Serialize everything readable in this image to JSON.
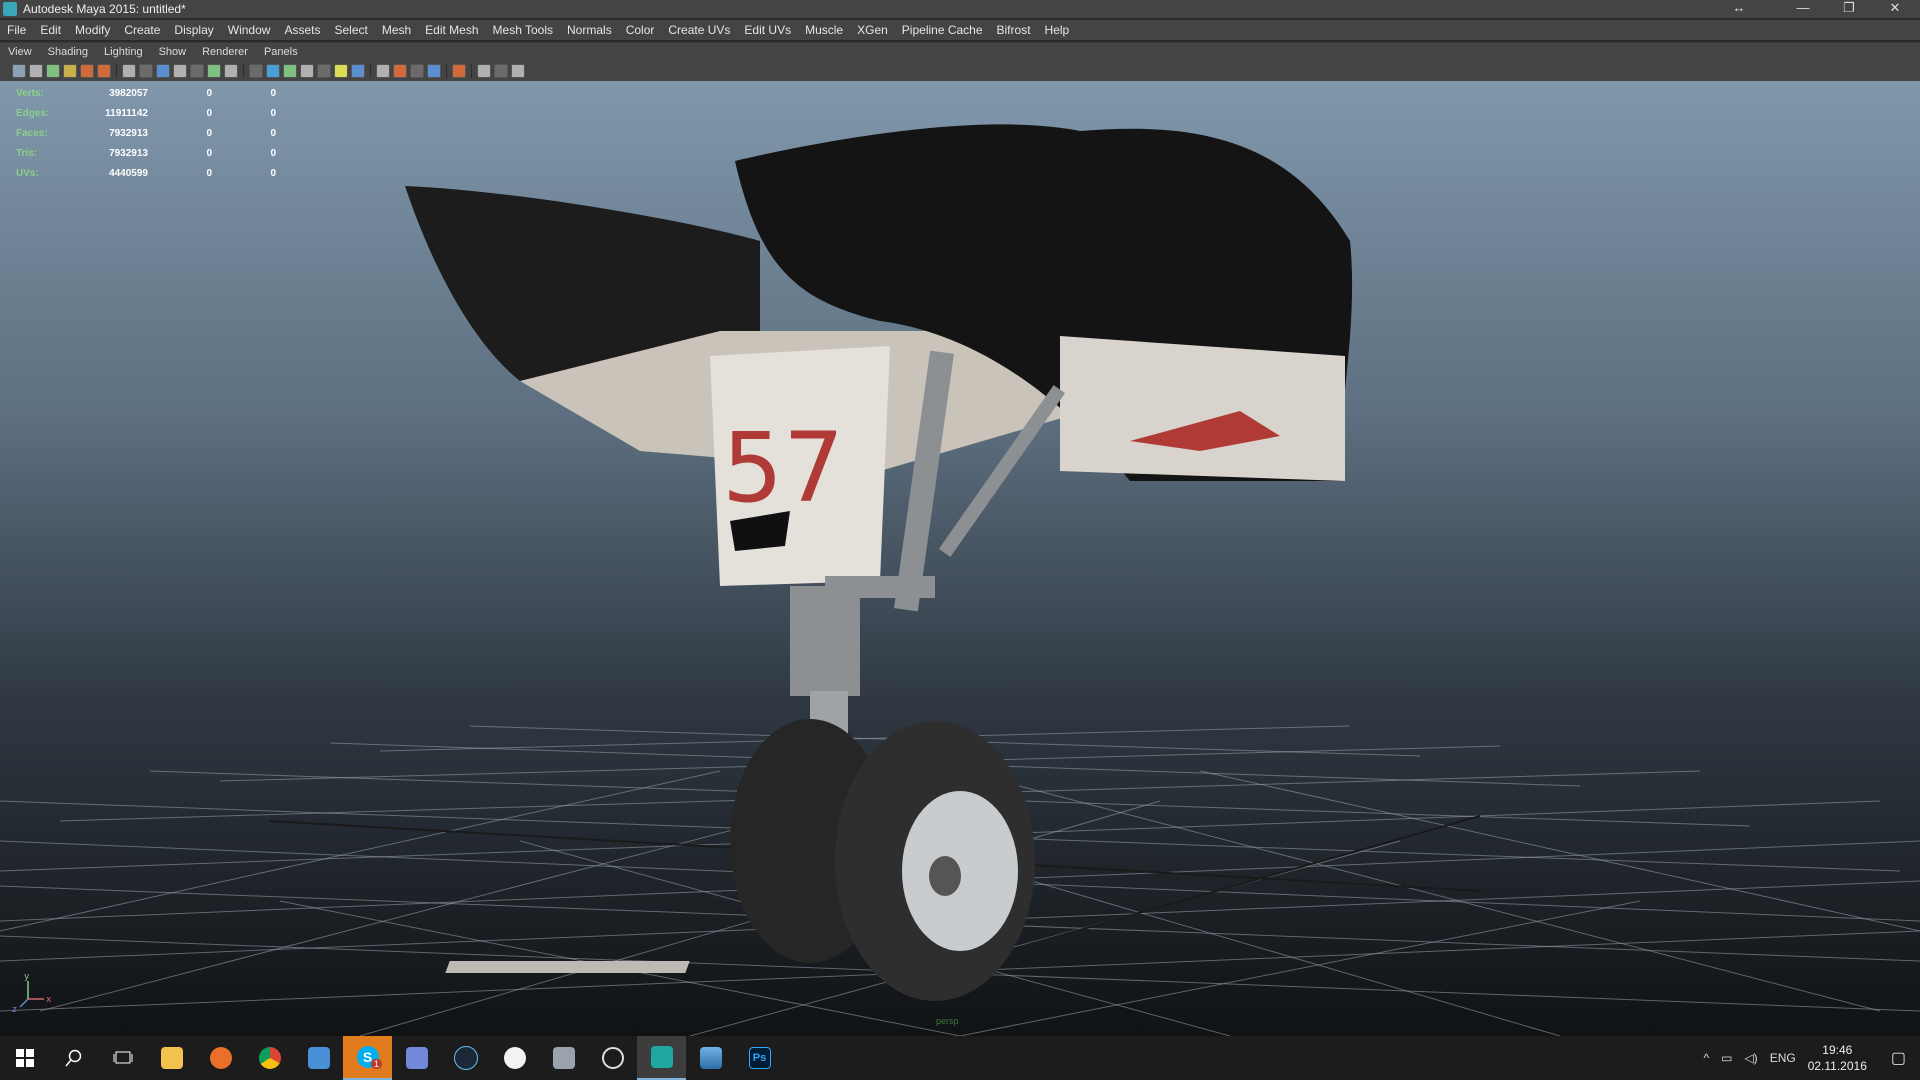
{
  "window": {
    "title": "Autodesk Maya 2015: untitled*",
    "controls": {
      "resize": "↔",
      "minimize": "—",
      "restore": "❐",
      "close": "✕"
    }
  },
  "menubar": [
    "File",
    "Edit",
    "Modify",
    "Create",
    "Display",
    "Window",
    "Assets",
    "Select",
    "Mesh",
    "Edit Mesh",
    "Mesh Tools",
    "Normals",
    "Color",
    "Create UVs",
    "Edit UVs",
    "Muscle",
    "XGen",
    "Pipeline Cache",
    "Bifrost",
    "Help"
  ],
  "panel_menu": [
    "View",
    "Shading",
    "Lighting",
    "Show",
    "Renderer",
    "Panels"
  ],
  "hud": [
    {
      "label": "Verts:",
      "value": "3982057",
      "sel": "0",
      "comp": "0"
    },
    {
      "label": "Edges:",
      "value": "11911142",
      "sel": "0",
      "comp": "0"
    },
    {
      "label": "Faces:",
      "value": "7932913",
      "sel": "0",
      "comp": "0"
    },
    {
      "label": "Tris:",
      "value": "7932913",
      "sel": "0",
      "comp": "0"
    },
    {
      "label": "UVs:",
      "value": "4440599",
      "sel": "0",
      "comp": "0"
    }
  ],
  "viewport": {
    "camera_label": "persp",
    "model_number": "57",
    "axis": {
      "y": "y",
      "x": "x",
      "z": "z"
    },
    "colors": {
      "top": "#8097ab",
      "bottom": "#101214",
      "grid": "#9aa4ad",
      "accent_red": "#b03a36"
    }
  },
  "taskbar": {
    "apps": [
      "start-icon",
      "search-icon",
      "task-view-icon",
      "file-explorer-icon",
      "firefox-icon",
      "chrome-icon",
      "app-icon",
      "skype-icon",
      "discord-icon",
      "steam-icon",
      "itunes-icon",
      "app-icon-2",
      "sync-icon",
      "maya-icon",
      "photos-icon",
      "photoshop-icon"
    ],
    "skype_badge": "1",
    "photoshop_label": "Ps",
    "language": "ENG",
    "time": "19:46",
    "date": "02.11.2016"
  }
}
